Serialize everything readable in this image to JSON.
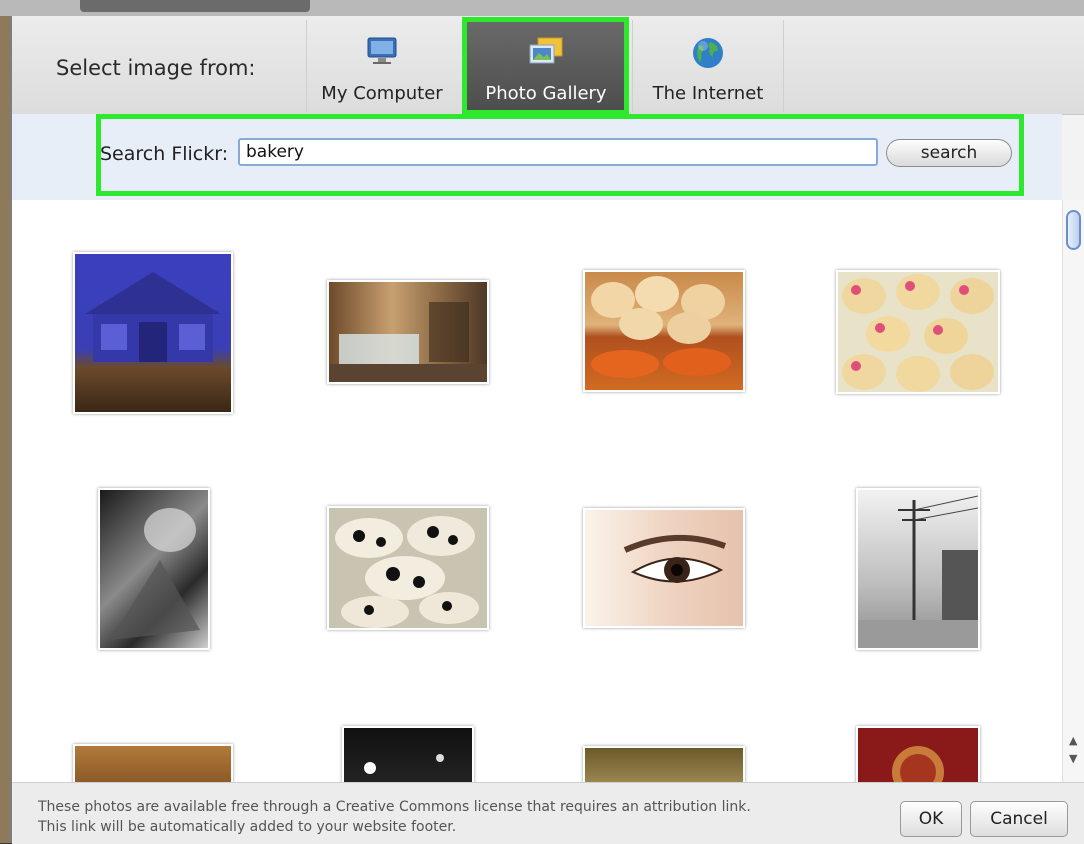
{
  "dialog": {
    "source_label": "Select image from:",
    "sources": [
      {
        "label": "My Computer",
        "icon": "monitor-icon",
        "selected": false
      },
      {
        "label": "Photo Gallery",
        "icon": "photo-gallery-icon",
        "selected": true
      },
      {
        "label": "The Internet",
        "icon": "globe-icon",
        "selected": false
      }
    ],
    "search": {
      "label": "Search Flickr:",
      "value": "bakery",
      "button": "search"
    },
    "gallery": {
      "thumbnails": [
        {
          "subject": "blue bakery storefront at night"
        },
        {
          "subject": "bakery interior with display case"
        },
        {
          "subject": "cream puffs and pastries on tray"
        },
        {
          "subject": "hello kitty cookies"
        },
        {
          "subject": "black and white bakery machinery"
        },
        {
          "subject": "cow-print decorated cookies"
        },
        {
          "subject": "close-up of an eye"
        },
        {
          "subject": "black and white street with utility poles"
        },
        {
          "subject": "baked goods in display"
        },
        {
          "subject": "night street scene"
        },
        {
          "subject": "sepia bakery photo"
        },
        {
          "subject": "red tart"
        }
      ]
    },
    "footer": {
      "note": "These photos are available free through a Creative Commons license that requires an attribution link. This link will be automatically added to your website footer.",
      "ok": "OK",
      "cancel": "Cancel"
    },
    "colors": {
      "highlight": "#2ee82e",
      "selected_tab": "#555555",
      "input_border": "#88a8d6"
    }
  }
}
